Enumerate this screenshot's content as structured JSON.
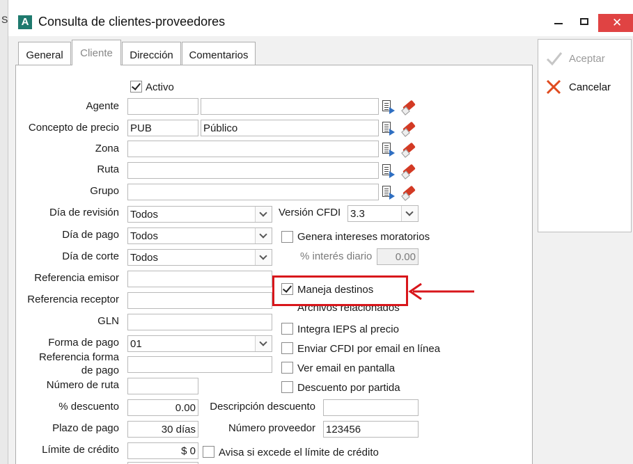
{
  "window": {
    "title": "Consulta de clientes-proveedores",
    "app_icon_letter": "A",
    "left_edge_letter": "S"
  },
  "tabs": [
    "General",
    "Cliente",
    "Dirección",
    "Comentarios"
  ],
  "actions": {
    "accept_label": "Aceptar",
    "cancel_label": "Cancelar"
  },
  "form": {
    "activo_label": "Activo",
    "agente": {
      "label": "Agente",
      "code": "",
      "name": ""
    },
    "concepto_precio": {
      "label": "Concepto de precio",
      "code": "PUB",
      "name": "Público"
    },
    "zona": {
      "label": "Zona",
      "value": ""
    },
    "ruta": {
      "label": "Ruta",
      "value": ""
    },
    "grupo": {
      "label": "Grupo",
      "value": ""
    },
    "dia_revision": {
      "label": "Día de revisión",
      "value": "Todos"
    },
    "dia_pago": {
      "label": "Día de pago",
      "value": "Todos"
    },
    "dia_corte": {
      "label": "Día de corte",
      "value": "Todos"
    },
    "version_cfdi": {
      "label": "Versión CFDI",
      "value": "3.3"
    },
    "genera_intereses_label": "Genera intereses moratorios",
    "interes_diario": {
      "label": "% interés diario",
      "value": "0.00"
    },
    "referencia_emisor": {
      "label": "Referencia emisor",
      "value": ""
    },
    "referencia_receptor": {
      "label": "Referencia receptor",
      "value": ""
    },
    "gln": {
      "label": "GLN",
      "value": ""
    },
    "forma_pago": {
      "label": "Forma de pago",
      "value": "01"
    },
    "referencia_forma_pago": {
      "label_line1": "Referencia forma",
      "label_line2": "de pago",
      "value": ""
    },
    "numero_ruta": {
      "label": "Número de ruta",
      "value": ""
    },
    "descuento": {
      "label": "% descuento",
      "value": "0.00"
    },
    "descripcion_descuento": {
      "label": "Descripción descuento",
      "value": ""
    },
    "plazo_pago": {
      "label": "Plazo de pago",
      "value": "30 días"
    },
    "numero_proveedor": {
      "label": "Número proveedor",
      "value": "123456"
    },
    "limite_credito": {
      "label": "Límite de crédito",
      "value": "$ 0"
    },
    "avisa_excede_label": "Avisa si excede el límite de crédito",
    "maneja_destinos_label": "Maneja destinos",
    "archivos_relacionados_label": "Archivos relacionados",
    "integra_ieps_label": "Integra IEPS al precio",
    "enviar_cfdi_label": "Enviar CFDI por email en línea",
    "ver_email_label": "Ver email en pantalla",
    "descuento_partida_label": "Descuento por partida"
  },
  "colors": {
    "highlight_red": "#d8161b",
    "app_icon_bg": "#1f7a6e",
    "close_button": "#e04343"
  }
}
